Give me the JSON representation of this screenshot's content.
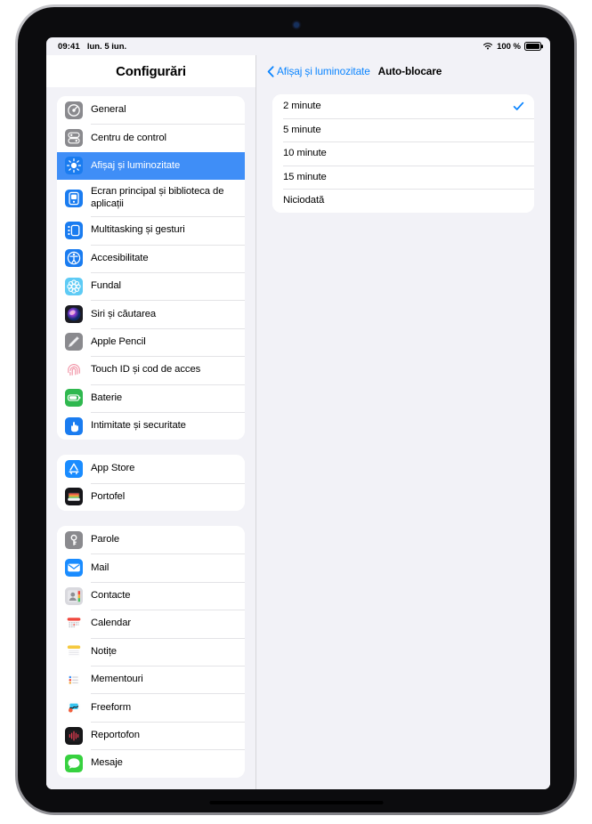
{
  "status_bar": {
    "time": "09:41",
    "date": "lun. 5 iun.",
    "battery_percent": "100 %",
    "wifi_icon": "wifi-icon",
    "battery_icon": "battery-full-icon"
  },
  "sidebar": {
    "title": "Configurări",
    "groups": [
      {
        "items": [
          {
            "label": "General",
            "icon": "gear-icon",
            "selected": false
          },
          {
            "label": "Centru de control",
            "icon": "control-center-icon",
            "selected": false
          },
          {
            "label": "Afișaj și luminozitate",
            "icon": "brightness-icon",
            "selected": true
          },
          {
            "label": "Ecran principal și biblioteca de aplicații",
            "icon": "home-screen-icon",
            "selected": false
          },
          {
            "label": "Multitasking și gesturi",
            "icon": "multitasking-icon",
            "selected": false
          },
          {
            "label": "Accesibilitate",
            "icon": "accessibility-icon",
            "selected": false
          },
          {
            "label": "Fundal",
            "icon": "wallpaper-icon",
            "selected": false
          },
          {
            "label": "Siri și căutarea",
            "icon": "siri-icon",
            "selected": false
          },
          {
            "label": "Apple Pencil",
            "icon": "pencil-icon",
            "selected": false
          },
          {
            "label": "Touch ID și cod de acces",
            "icon": "touch-id-icon",
            "selected": false
          },
          {
            "label": "Baterie",
            "icon": "battery-icon",
            "selected": false
          },
          {
            "label": "Intimitate și securitate",
            "icon": "privacy-hand-icon",
            "selected": false
          }
        ]
      },
      {
        "items": [
          {
            "label": "App Store",
            "icon": "app-store-icon",
            "selected": false
          },
          {
            "label": "Portofel",
            "icon": "wallet-icon",
            "selected": false
          }
        ]
      },
      {
        "items": [
          {
            "label": "Parole",
            "icon": "passwords-key-icon",
            "selected": false
          },
          {
            "label": "Mail",
            "icon": "mail-icon",
            "selected": false
          },
          {
            "label": "Contacte",
            "icon": "contacts-icon",
            "selected": false
          },
          {
            "label": "Calendar",
            "icon": "calendar-icon",
            "selected": false
          },
          {
            "label": "Notițe",
            "icon": "notes-icon",
            "selected": false
          },
          {
            "label": "Mementouri",
            "icon": "reminders-icon",
            "selected": false
          },
          {
            "label": "Freeform",
            "icon": "freeform-icon",
            "selected": false
          },
          {
            "label": "Reportofon",
            "icon": "voice-memos-icon",
            "selected": false
          },
          {
            "label": "Mesaje",
            "icon": "messages-icon",
            "selected": false
          }
        ]
      }
    ]
  },
  "detail": {
    "back_label": "Afișaj și luminozitate",
    "title": "Auto-blocare",
    "options": [
      {
        "label": "2 minute",
        "checked": true
      },
      {
        "label": "5 minute",
        "checked": false
      },
      {
        "label": "10 minute",
        "checked": false
      },
      {
        "label": "15 minute",
        "checked": false
      },
      {
        "label": "Niciodată",
        "checked": false
      }
    ]
  },
  "colors": {
    "accent_blue": "#0a84ff",
    "selection_blue": "#3f8ef7",
    "group_bg": "#f2f2f7"
  }
}
